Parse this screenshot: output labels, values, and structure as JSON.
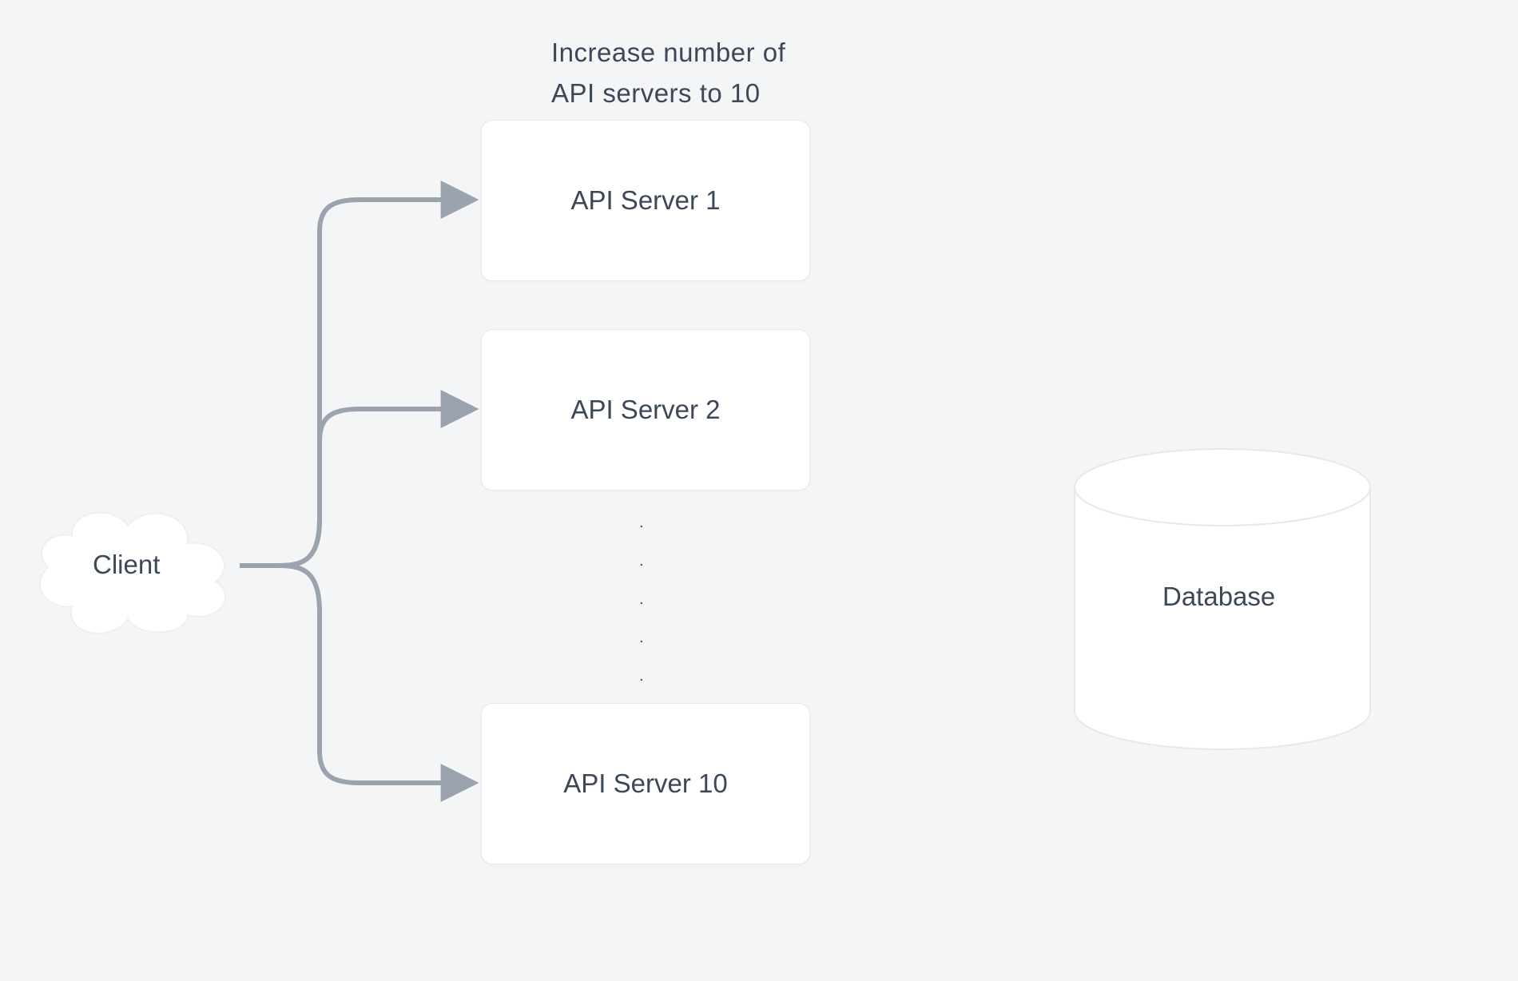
{
  "caption_line1": "Increase number of",
  "caption_line2": "API servers to 10",
  "client": "Client",
  "servers": {
    "s1": "API Server 1",
    "s2": "API Server 2",
    "s10": "API Server 10"
  },
  "database": "Database"
}
